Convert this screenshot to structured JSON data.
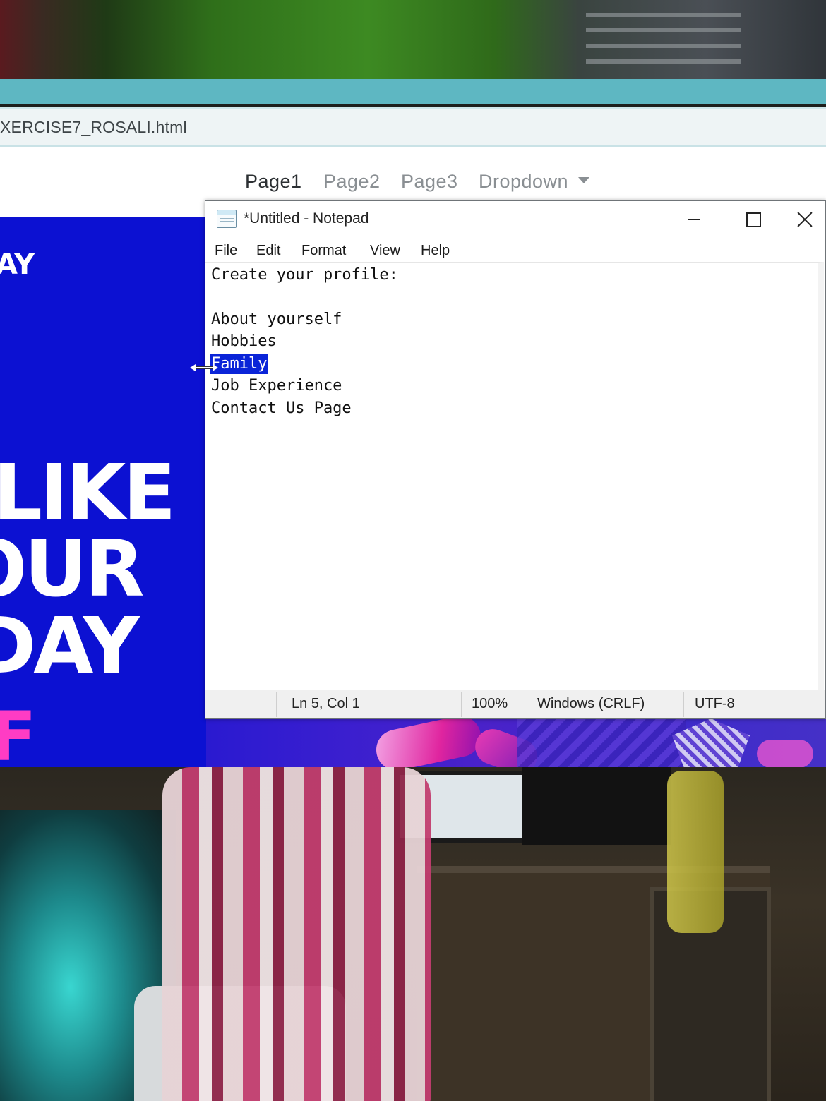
{
  "browser": {
    "address_text": "XERCISE7_ROSALI.html"
  },
  "webpage": {
    "nav": {
      "items": [
        {
          "label": "Page1",
          "active": true
        },
        {
          "label": "Page2",
          "active": false
        },
        {
          "label": "Page3",
          "active": false
        },
        {
          "label": "Dropdown",
          "active": false
        }
      ]
    },
    "hero": {
      "small_text": "AY",
      "line1": "LIKE",
      "line2": "OUR",
      "line3": "DAY",
      "accent_text": "F"
    }
  },
  "notepad": {
    "title": "*Untitled - Notepad",
    "menu": [
      "File",
      "Edit",
      "Format",
      "View",
      "Help"
    ],
    "lines": [
      "Create your profile:",
      "",
      "About yourself",
      "Hobbies",
      "Family",
      "Job Experience",
      "Contact Us Page"
    ],
    "selected_text": "Family",
    "status": {
      "position": "Ln 5, Col 1",
      "zoom": "100%",
      "line_ending": "Windows (CRLF)",
      "encoding": "UTF-8"
    }
  },
  "colors": {
    "browser_top": "#5eb7c2",
    "hero_blue": "#0c11d2",
    "hero_accent": "#ff3cc4",
    "selection": "#0a24d8"
  }
}
